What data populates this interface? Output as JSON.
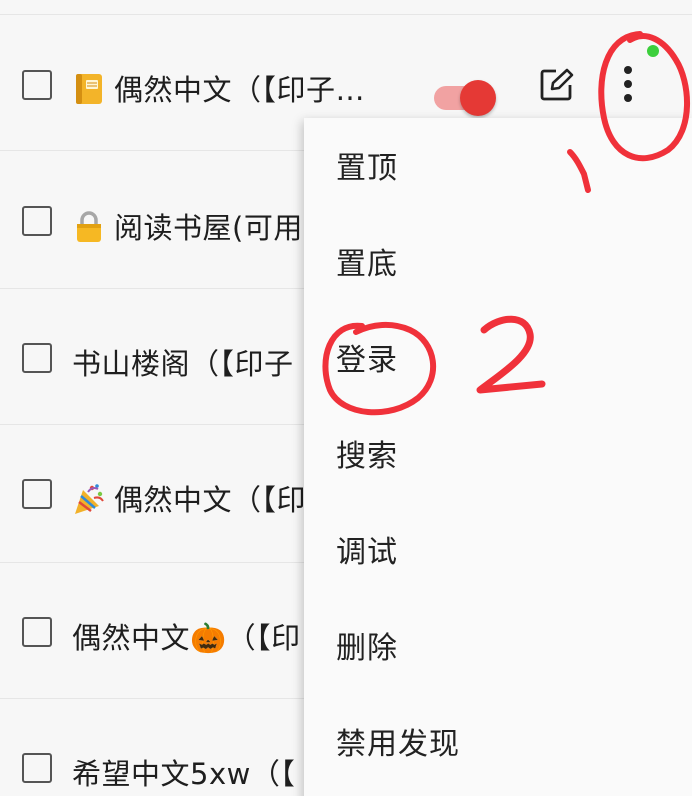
{
  "list": {
    "items": [
      {
        "title": "偶然中文（【印子…",
        "emoji": "notebook-icon"
      },
      {
        "title": "阅读书屋(可用",
        "emoji": "lock-icon"
      },
      {
        "title": "书山楼阁（【印子",
        "emoji": ""
      },
      {
        "title": "偶然中文（【印",
        "emoji": "party-popper-icon"
      },
      {
        "title": "偶然中文🎃（【印",
        "emoji": ""
      },
      {
        "title": "希望中文5xw（【",
        "emoji": ""
      }
    ],
    "first_row_enabled": true
  },
  "menu": {
    "items": [
      {
        "label": "置顶"
      },
      {
        "label": "置底"
      },
      {
        "label": "登录"
      },
      {
        "label": "搜索"
      },
      {
        "label": "调试"
      },
      {
        "label": "删除"
      },
      {
        "label": "禁用发现"
      }
    ]
  },
  "annotations": {
    "step1": "1",
    "step2": "2",
    "ink_color": "#f0313a"
  },
  "colors": {
    "accent": "#e53935",
    "accent_light": "#f1a2a2",
    "status_dot": "#3ccf3c"
  }
}
